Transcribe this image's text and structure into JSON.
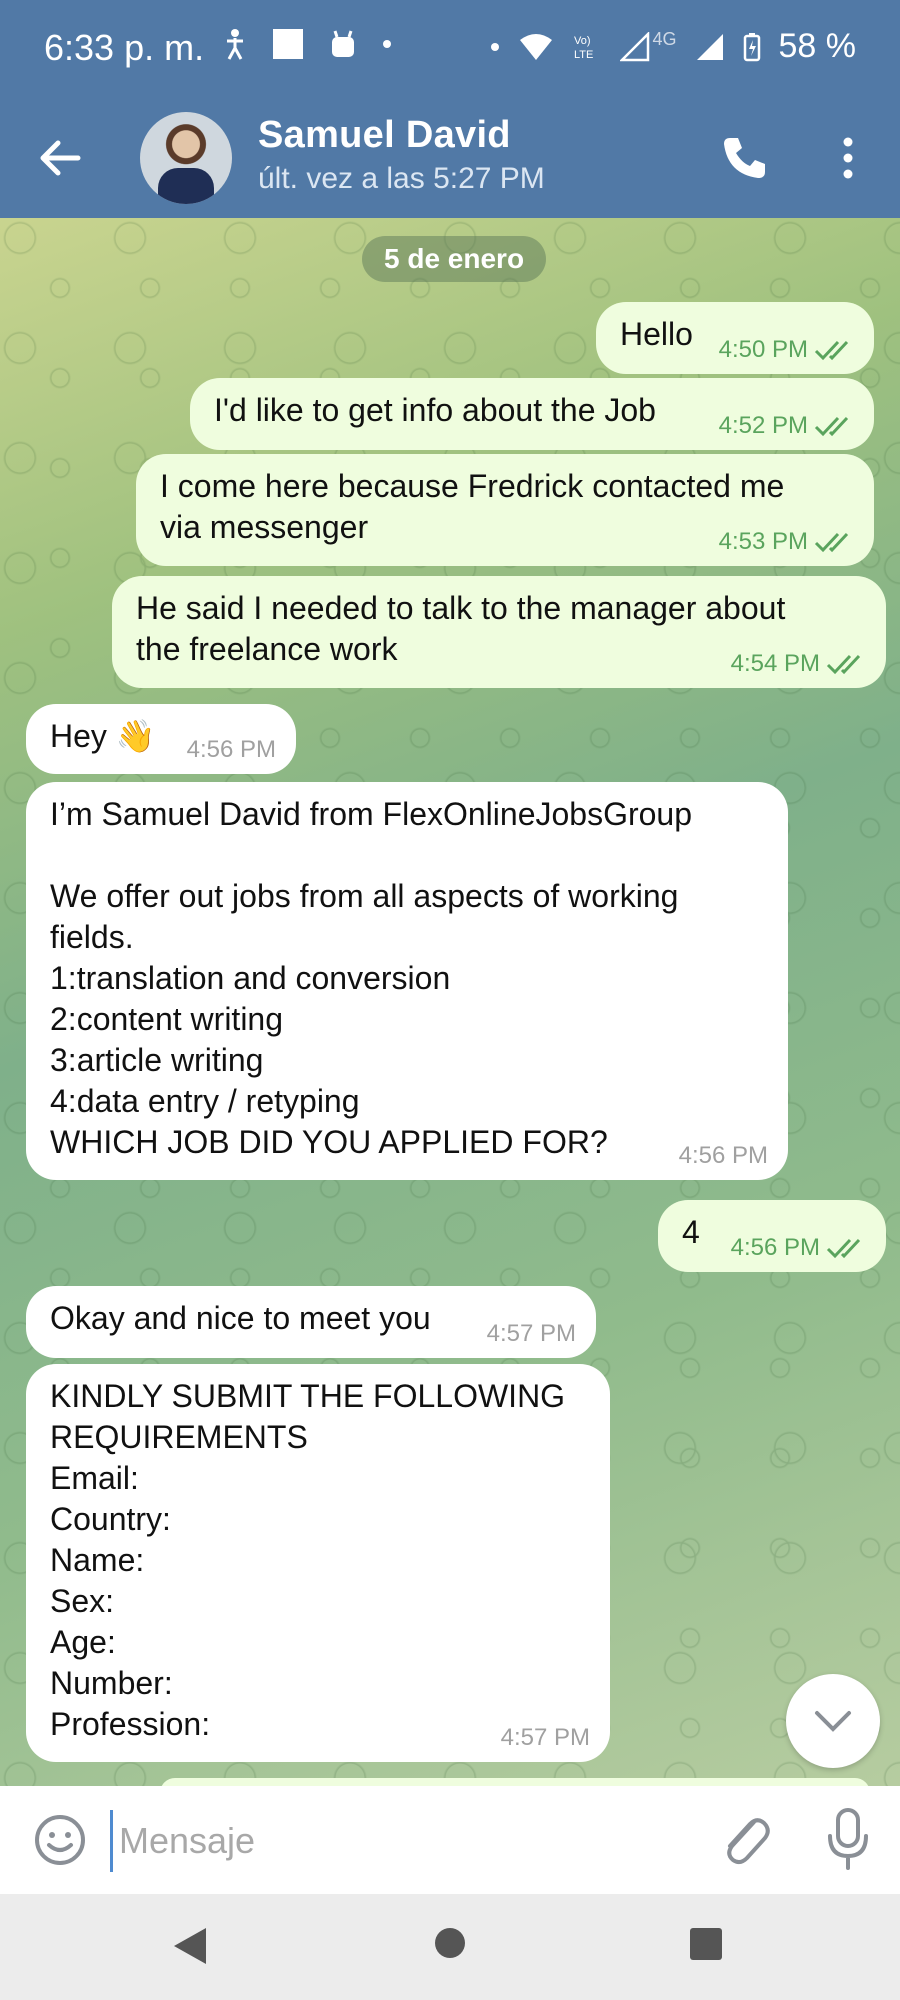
{
  "status_bar": {
    "time": "6:33 p. m.",
    "battery": "58 %",
    "network_label": "4G"
  },
  "header": {
    "contact_name": "Samuel David",
    "contact_status": "últ. vez a las 5:27 PM"
  },
  "chat": {
    "date_chip": "5 de enero",
    "messages": [
      {
        "direction": "out",
        "text": "Hello",
        "time": "4:50 PM",
        "read": true
      },
      {
        "direction": "out",
        "text": "I'd like to get info about the Job",
        "time": "4:52 PM",
        "read": true
      },
      {
        "direction": "out",
        "text": "I come here because Fredrick contacted me\nvia messenger",
        "time": "4:53 PM",
        "read": true
      },
      {
        "direction": "out",
        "text": "He said I needed to talk to the manager about\nthe freelance work",
        "time": "4:54 PM",
        "read": true
      },
      {
        "direction": "in",
        "text": "Hey 👋",
        "time": "4:56 PM"
      },
      {
        "direction": "in",
        "text": "I’m Samuel David from FlexOnlineJobsGroup\n\nWe offer out jobs from all aspects of working\nfields.\n1:translation and conversion\n2:content writing\n3:article writing\n4:data entry / retyping\nWHICH JOB DID YOU APPLIED FOR?",
        "time": "4:56 PM"
      },
      {
        "direction": "out",
        "text": "4",
        "time": "4:56 PM",
        "read": true
      },
      {
        "direction": "in",
        "text": "Okay and nice to meet you",
        "time": "4:57 PM"
      },
      {
        "direction": "in",
        "text": "KINDLY SUBMIT THE FOLLOWING\nREQUIREMENTS\nEmail:\nCountry:\nName:\nSex:\nAge:\nNumber:\nProfession:",
        "time": "4:57 PM"
      }
    ]
  },
  "composer": {
    "placeholder": "Mensaje"
  },
  "colors": {
    "header": "#5179a6",
    "outgoing_bubble": "#effdde",
    "incoming_bubble": "#ffffff",
    "read_check": "#5aa45d"
  }
}
